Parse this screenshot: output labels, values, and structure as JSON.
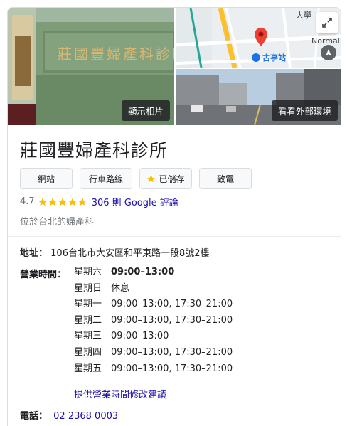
{
  "photos": {
    "main_label": "顯示相片",
    "street_label": "看看外部環境",
    "map": {
      "label_top": "大學",
      "label_normal": "Normal",
      "station": "古亭站"
    },
    "sign_text": "莊國豐婦產科診所"
  },
  "place": {
    "title": "莊國豐婦產科診所",
    "rating": "4.7",
    "rating_value": 4.7,
    "reviews_link": "306 則 Google 評論",
    "category": "位於台北的婦產科"
  },
  "actions": [
    {
      "label": "網站",
      "icon": ""
    },
    {
      "label": "行車路線",
      "icon": ""
    },
    {
      "label": "已儲存",
      "icon": "star-icon"
    },
    {
      "label": "致電",
      "icon": ""
    }
  ],
  "address": {
    "label": "地址：",
    "value": "106台北市大安區和平東路一段8號2樓"
  },
  "hours": {
    "label": "營業時間：",
    "rows": [
      {
        "day": "星期六",
        "time": "09:00–13:00",
        "today": true
      },
      {
        "day": "星期日",
        "time": "休息",
        "today": false
      },
      {
        "day": "星期一",
        "time": "09:00–13:00, 17:30–21:00",
        "today": false
      },
      {
        "day": "星期二",
        "time": "09:00–13:00, 17:30–21:00",
        "today": false
      },
      {
        "day": "星期三",
        "time": "09:00–13:00",
        "today": false
      },
      {
        "day": "星期四",
        "time": "09:00–13:00, 17:30–21:00",
        "today": false
      },
      {
        "day": "星期五",
        "time": "09:00–13:00, 17:30–21:00",
        "today": false
      }
    ],
    "suggest_link": "提供營業時間修改建議"
  },
  "phone": {
    "label": "電話：",
    "value": "02 2368 0003"
  },
  "colors": {
    "link": "#1a0dab",
    "star": "#fbbc04",
    "pin": "#ea4335"
  }
}
